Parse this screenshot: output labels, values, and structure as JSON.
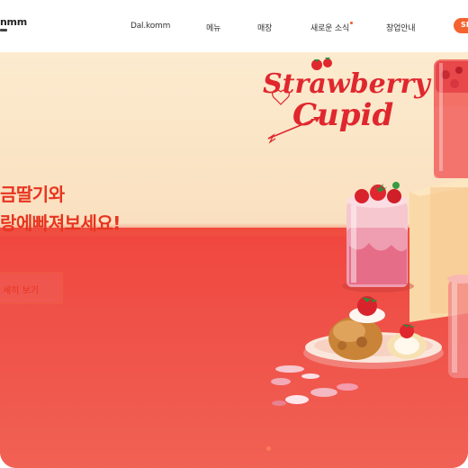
{
  "header": {
    "logo": "nmm",
    "nav": [
      {
        "label": "Dal.komm"
      },
      {
        "label": "메뉴"
      },
      {
        "label": "매장"
      },
      {
        "label": "새로운 소식"
      },
      {
        "label": "창업안내"
      }
    ],
    "cta_label": "SI"
  },
  "hero": {
    "headline_line1": "금딸기와",
    "headline_line2": "랑에빠져보세요!",
    "detail_button": "세히 보기",
    "script_line1": "Strawberry",
    "script_line2": "Cupid"
  },
  "colors": {
    "accent": "#f4622e",
    "headline": "#e8341f",
    "script": "#e0272e",
    "wall": "#fbe8c9",
    "floor": "#f0584a"
  }
}
